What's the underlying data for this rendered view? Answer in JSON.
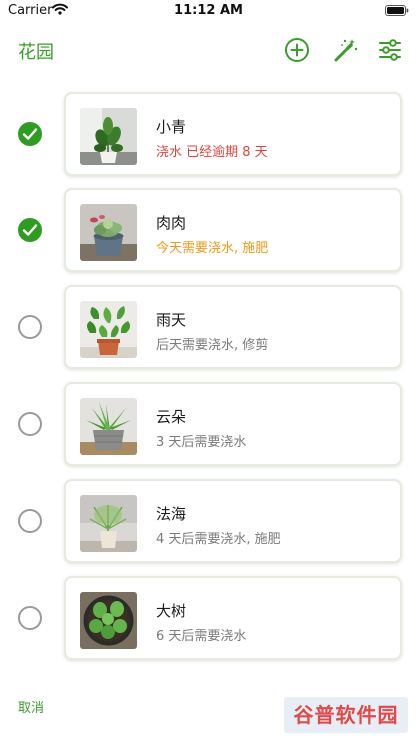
{
  "status_bar": {
    "carrier": "Carrier",
    "time": "11:12 AM"
  },
  "nav": {
    "title": "花园",
    "add_icon": "plus-circle-icon",
    "wand_icon": "magic-wand-icon",
    "settings_icon": "sliders-icon"
  },
  "colors": {
    "accent_green": "#3a9d2a",
    "overdue_red": "#e0443e",
    "today_orange": "#ee9a1c",
    "upcoming_gray": "#7b7b7b"
  },
  "plants": [
    {
      "name": "小青",
      "status": "浇水 已经逾期 8 天",
      "status_kind": "overdue",
      "selected": true
    },
    {
      "name": "肉肉",
      "status": "今天需要浇水, 施肥",
      "status_kind": "today",
      "selected": true
    },
    {
      "name": "雨天",
      "status": "后天需要浇水, 修剪",
      "status_kind": "upcoming",
      "selected": false
    },
    {
      "name": "云朵",
      "status": "3 天后需要浇水",
      "status_kind": "upcoming",
      "selected": false
    },
    {
      "name": "法海",
      "status": "4 天后需要浇水, 施肥",
      "status_kind": "upcoming",
      "selected": false
    },
    {
      "name": "大树",
      "status": "6 天后需要浇水",
      "status_kind": "upcoming",
      "selected": false
    }
  ],
  "footer": {
    "cancel_label": "取消",
    "watermark": "谷普软件园"
  }
}
